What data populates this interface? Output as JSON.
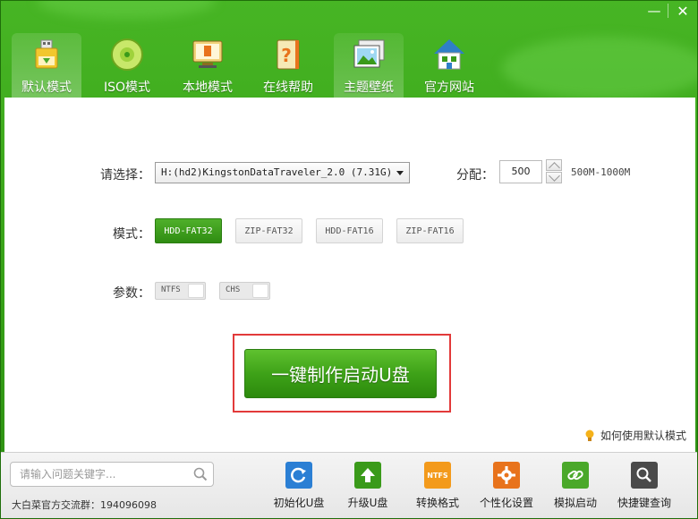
{
  "window": {
    "min_label": "—",
    "close_label": "✕"
  },
  "tabs": [
    {
      "label": "默认模式",
      "icon": "usb-drive-icon",
      "active": true
    },
    {
      "label": "ISO模式",
      "icon": "disc-icon",
      "active": false
    },
    {
      "label": "本地模式",
      "icon": "monitor-icon",
      "active": false
    },
    {
      "label": "在线帮助",
      "icon": "help-book-icon",
      "active": false
    },
    {
      "label": "主题壁纸",
      "icon": "wallpaper-icon",
      "active": false
    },
    {
      "label": "官方网站",
      "icon": "home-icon",
      "active": false
    }
  ],
  "form": {
    "select_label": "请选择：",
    "select_value": "H:(hd2)KingstonDataTraveler_2.0 (7.31G)",
    "alloc_label": "分配：",
    "alloc_value": "500",
    "alloc_range": "500M-1000M",
    "mode_label": "模式：",
    "modes": [
      "HDD-FAT32",
      "ZIP-FAT32",
      "HDD-FAT16",
      "ZIP-FAT16"
    ],
    "mode_selected": "HDD-FAT32",
    "param_label": "参数：",
    "params": [
      "NTFS",
      "CHS"
    ]
  },
  "make_button": "一键制作启动U盘",
  "help_link": "如何使用默认模式",
  "bottom": {
    "search_placeholder": "请输入问题关键字...",
    "qq_group": "大白菜官方交流群：194096098",
    "tools": [
      {
        "label": "初始化U盘",
        "icon": "refresh-icon",
        "color": "#2b7fd4"
      },
      {
        "label": "升级U盘",
        "icon": "upgrade-arrow-icon",
        "color": "#3a9a1a"
      },
      {
        "label": "转换格式",
        "icon": "ntfs-icon",
        "color": "#f39a1c",
        "text": "NTFS"
      },
      {
        "label": "个性化设置",
        "icon": "gear-icon",
        "color": "#e8731c"
      },
      {
        "label": "模拟启动",
        "icon": "link-icon",
        "color": "#4aa82a"
      },
      {
        "label": "快捷键查询",
        "icon": "search-icon",
        "color": "#4a4a4a"
      }
    ]
  },
  "colors": {
    "brand_green": "#3a9a1a",
    "highlight_red": "#e23a3a"
  }
}
